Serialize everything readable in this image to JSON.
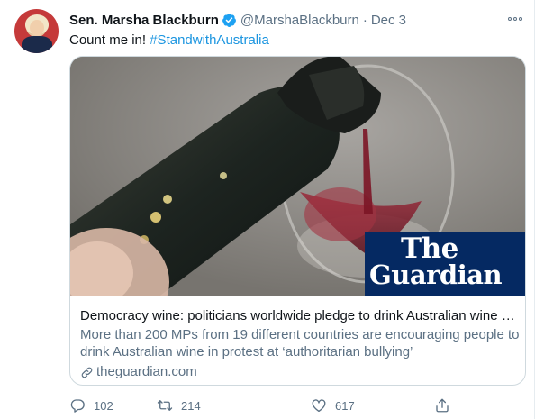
{
  "tweet": {
    "author_name": "Sen. Marsha Blackburn",
    "handle": "@MarshaBlackburn",
    "separator": "·",
    "date": "Dec 3",
    "text_plain": "Count me in! ",
    "hashtag": "#StandwithAustralia"
  },
  "card": {
    "image_logo_line1": "The",
    "image_logo_line2": "Guardian",
    "title": "Democracy wine: politicians worldwide pledge to drink Australian wine i…",
    "description": "More than 200 MPs from 19 different countries are encouraging people to drink Australian wine in protest at ‘authoritarian bullying’",
    "domain": "theguardian.com"
  },
  "actions": {
    "replies": "102",
    "retweets": "214",
    "likes": "617"
  },
  "colors": {
    "link_blue": "#1b95e0",
    "verified_blue": "#1da1f2",
    "secondary_text": "#5b7083",
    "guardian_navy": "#052962"
  },
  "icons": [
    "verified-badge-icon",
    "more-options-icon",
    "link-icon",
    "reply-icon",
    "retweet-icon",
    "like-icon",
    "share-icon"
  ]
}
